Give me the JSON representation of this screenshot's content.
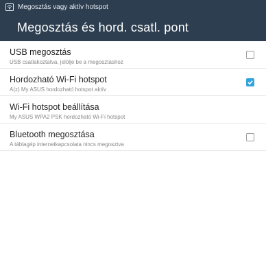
{
  "status_bar": {
    "icon": "wifi-hotspot-icon",
    "text": "Megosztás vagy aktív hotspot"
  },
  "action_bar": {
    "title": "Megosztás és hord. csatl. pont"
  },
  "settings": [
    {
      "title": "USB megosztás",
      "summary": "USB csatlakoztatva, jelölje be a megosztáshoz",
      "checkbox": true,
      "checked": false
    },
    {
      "title": "Hordozható Wi-Fi hotspot",
      "summary": "A(z) My ASUS hordozható hotspot aktív",
      "checkbox": true,
      "checked": true
    },
    {
      "title": "Wi-Fi hotspot beállítása",
      "summary": "My ASUS WPA2 PSK hordozható Wi-Fi hotspot",
      "checkbox": false
    },
    {
      "title": "Bluetooth megosztása",
      "summary": "A táblagép internetkapcsolata nincs megosztva",
      "checkbox": true,
      "checked": false
    }
  ],
  "colors": {
    "header": "#2d3e50",
    "accent": "#33a3dc"
  }
}
